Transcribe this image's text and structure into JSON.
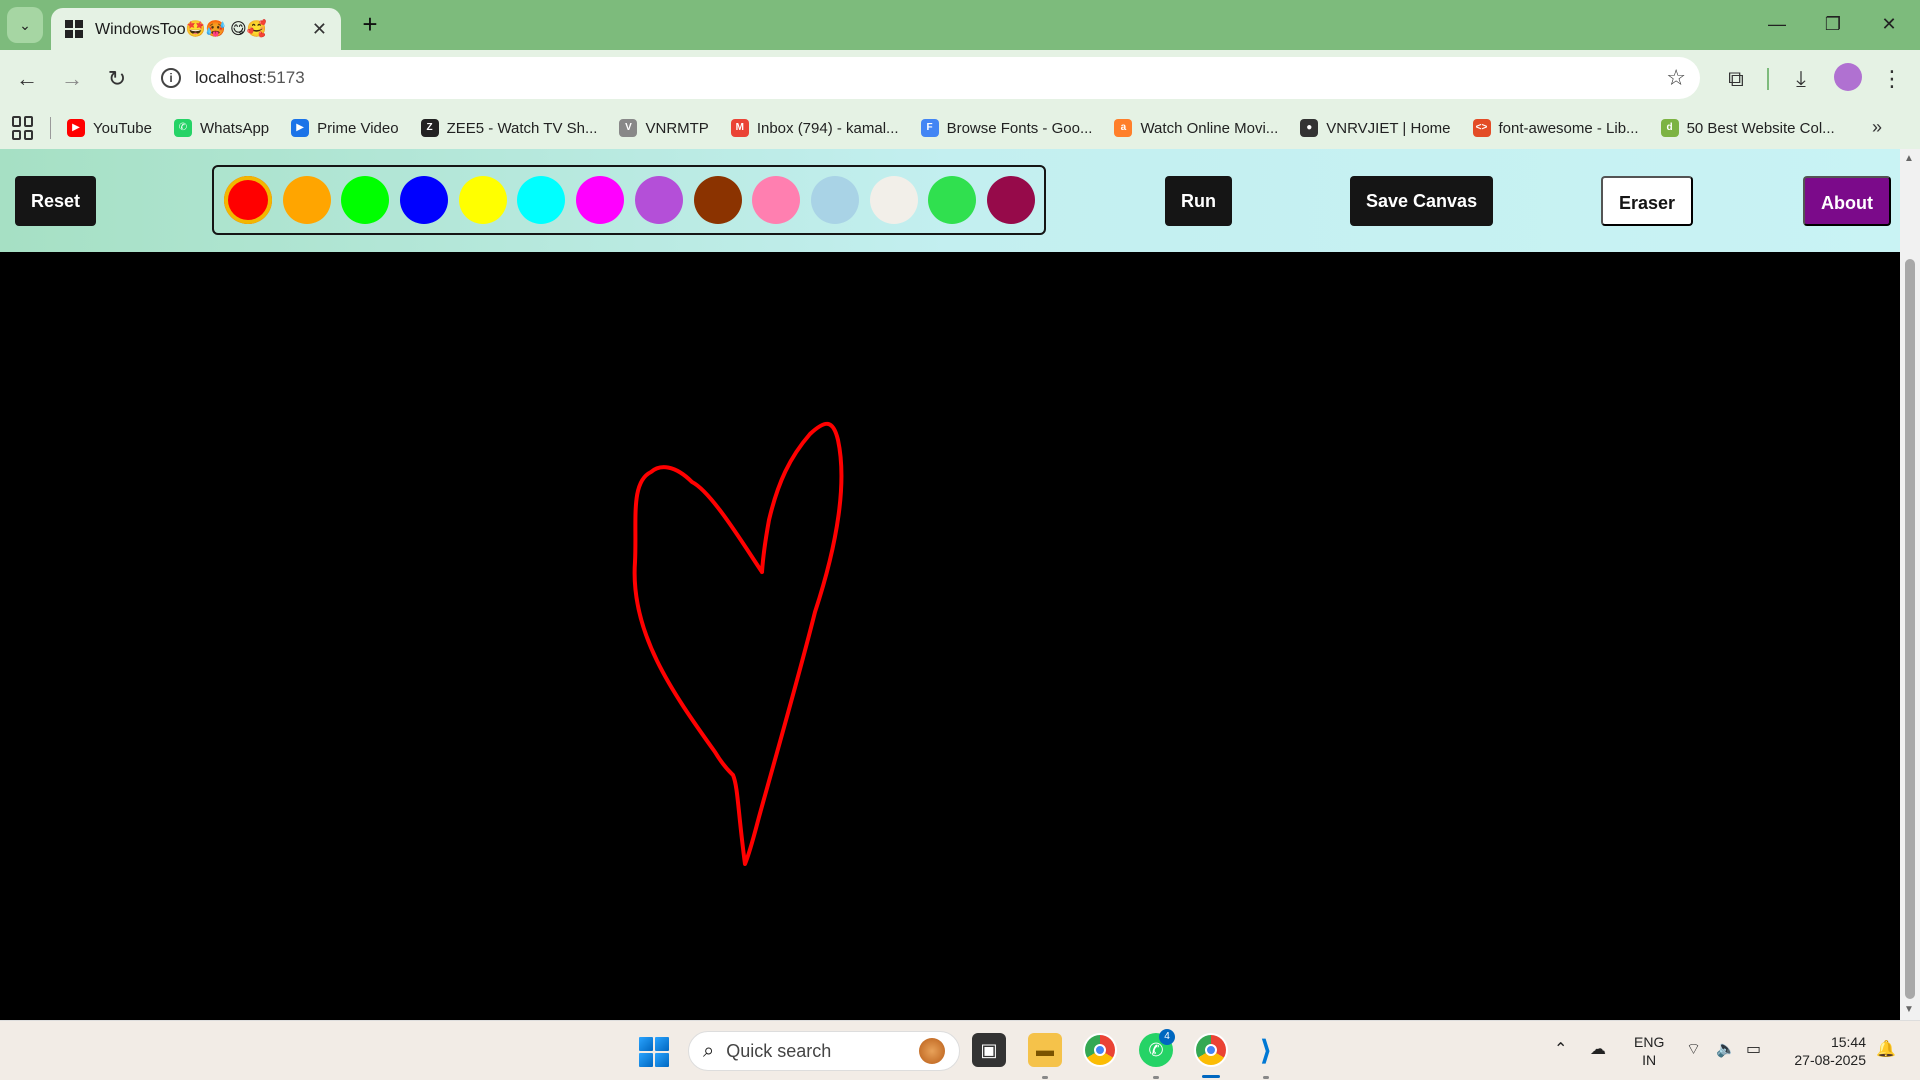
{
  "browser": {
    "tab_title": "WindowsToo🤩🥵 😋🥰",
    "url_host": "localhost",
    "url_port": ":5173",
    "bookmarks": [
      {
        "label": "YouTube",
        "color": "#ff0000",
        "glyph": "▶"
      },
      {
        "label": "WhatsApp",
        "color": "#25d366",
        "glyph": "✆"
      },
      {
        "label": "Prime Video",
        "color": "#1a73e8",
        "glyph": "▶"
      },
      {
        "label": "ZEE5 - Watch TV Sh...",
        "color": "#222222",
        "glyph": "Z"
      },
      {
        "label": "VNRMTP",
        "color": "#888888",
        "glyph": "V"
      },
      {
        "label": "Inbox (794) - kamal...",
        "color": "#ea4335",
        "glyph": "M"
      },
      {
        "label": "Browse Fonts - Goo...",
        "color": "#4285f4",
        "glyph": "F"
      },
      {
        "label": "Watch Online Movi...",
        "color": "#ff7f2a",
        "glyph": "a"
      },
      {
        "label": "VNRVJIET | Home",
        "color": "#333333",
        "glyph": "●"
      },
      {
        "label": "font-awesome - Lib...",
        "color": "#e34c26",
        "glyph": "<>"
      },
      {
        "label": "50 Best Website Col...",
        "color": "#7cb342",
        "glyph": "d"
      }
    ]
  },
  "app": {
    "reset_label": "Reset",
    "run_label": "Run",
    "save_label": "Save Canvas",
    "eraser_label": "Eraser",
    "about_label": "About",
    "palette": [
      {
        "color": "#ff0000",
        "selected": true
      },
      {
        "color": "#ffa500",
        "selected": false
      },
      {
        "color": "#00ff00",
        "selected": false
      },
      {
        "color": "#0000ff",
        "selected": false
      },
      {
        "color": "#ffff00",
        "selected": false
      },
      {
        "color": "#00ffff",
        "selected": false
      },
      {
        "color": "#ff00ff",
        "selected": false
      },
      {
        "color": "#b44fd8",
        "selected": false
      },
      {
        "color": "#8b3300",
        "selected": false
      },
      {
        "color": "#ff7fb0",
        "selected": false
      },
      {
        "color": "#a9d3e6",
        "selected": false
      },
      {
        "color": "#f2efe9",
        "selected": false
      },
      {
        "color": "#30e04f",
        "selected": false
      },
      {
        "color": "#960a4a",
        "selected": false
      }
    ],
    "canvas_background": "#000000",
    "stroke_color": "#ff0000"
  },
  "taskbar": {
    "search_placeholder": "Quick search",
    "lang_line1": "ENG",
    "lang_line2": "IN",
    "time": "15:44",
    "date": "27-08-2025",
    "whatsapp_badge": "4"
  }
}
